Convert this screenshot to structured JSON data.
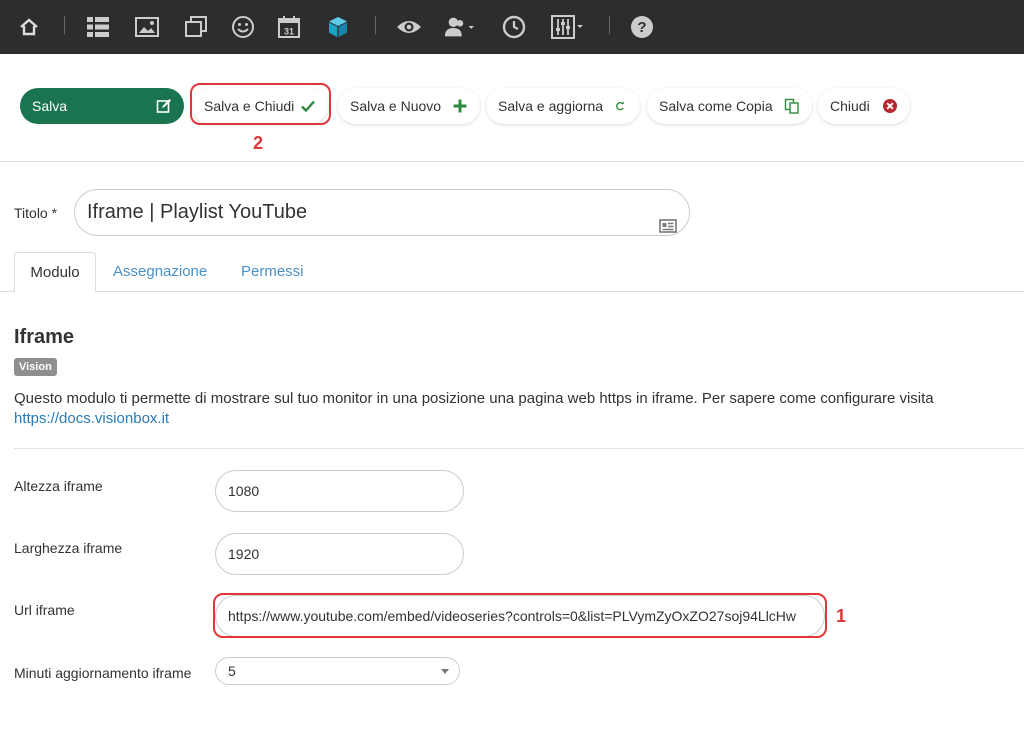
{
  "nav": {
    "icons": [
      "home-icon",
      "list-icon",
      "image-icon",
      "copy-icon",
      "smiley-icon",
      "calendar-icon",
      "cube-icon",
      "eye-icon",
      "users-icon",
      "clock-icon",
      "sliders-icon",
      "help-icon"
    ],
    "calendar_day": "31",
    "help_glyph": "?"
  },
  "toolbar": {
    "save": "Salva",
    "save_close": "Salva e Chiudi",
    "save_new": "Salva e Nuovo",
    "save_refresh": "Salva e aggiorna",
    "save_copy": "Salva come Copia",
    "close": "Chiudi",
    "annotation_2": "2"
  },
  "title_field": {
    "label": "Titolo *",
    "value": "Iframe | Playlist YouTube"
  },
  "tabs": [
    "Modulo",
    "Assegnazione",
    "Permessi"
  ],
  "module": {
    "title": "Iframe",
    "badge": "Vision",
    "description": "Questo modulo ti permette di mostrare sul tuo monitor in una posizione una pagina web https in iframe. Per sapere come configurare visita",
    "link": "https://docs.visionbox.it"
  },
  "fields": {
    "height_label": "Altezza iframe",
    "height_value": "1080",
    "width_label": "Larghezza iframe",
    "width_value": "1920",
    "url_label": "Url iframe",
    "url_value": "https://www.youtube.com/embed/videoseries?controls=0&list=PLVymZyOxZO27soj94LlcHw",
    "annotation_1": "1",
    "refresh_label": "Minuti aggiornamento iframe",
    "refresh_value": "5"
  },
  "colors": {
    "nav_bg": "#2d2d2d",
    "primary": "#19744f",
    "annotation": "#e0383a",
    "link": "#2a7ab5",
    "cube": "#1aa3c8"
  }
}
